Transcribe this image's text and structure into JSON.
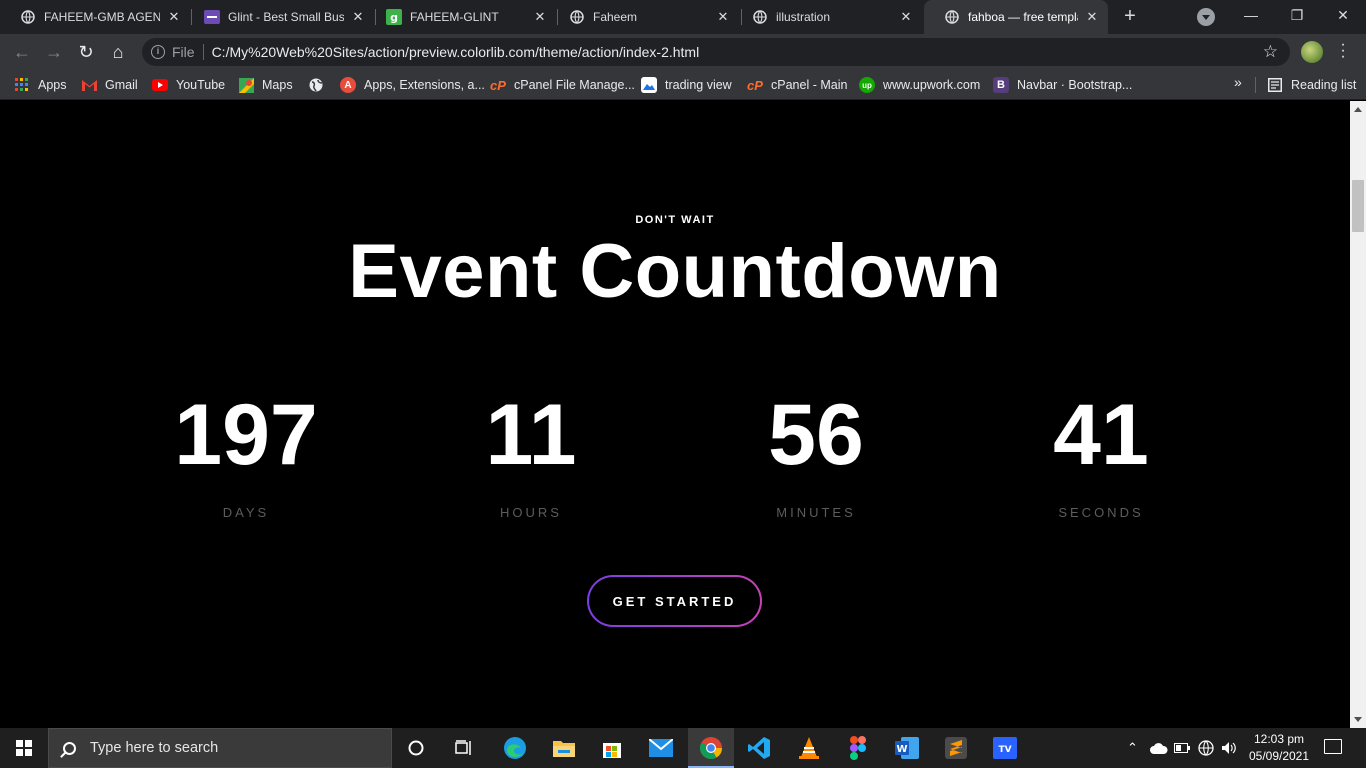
{
  "browser": {
    "tabs": [
      {
        "title": "FAHEEM-GMB AGENC",
        "favicon": "globe-icon",
        "active": false
      },
      {
        "title": "Glint - Best Small Busi",
        "favicon": "colorlib-icon",
        "active": false
      },
      {
        "title": "FAHEEM-GLINT",
        "favicon": "green-g-icon",
        "active": false
      },
      {
        "title": "Faheem",
        "favicon": "globe-icon",
        "active": false
      },
      {
        "title": "illustration",
        "favicon": "globe-icon",
        "active": false
      },
      {
        "title": "fahboa — free templat",
        "favicon": "globe-icon",
        "active": true
      }
    ],
    "address": {
      "scheme_label": "File",
      "url": "C:/My%20Web%20Sites/action/preview.colorlib.com/theme/action/index-2.html"
    },
    "bookmarks": [
      {
        "label": "Apps",
        "icon": "apps-grid-icon"
      },
      {
        "label": "Gmail",
        "icon": "gmail-icon"
      },
      {
        "label": "YouTube",
        "icon": "youtube-icon"
      },
      {
        "label": "Maps",
        "icon": "maps-icon"
      },
      {
        "label": "",
        "icon": "globe-icon"
      },
      {
        "label": "Apps, Extensions, a...",
        "icon": "red-a-icon"
      },
      {
        "label": "cPanel File Manage...",
        "icon": "cpanel-icon"
      },
      {
        "label": "trading view",
        "icon": "image-icon"
      },
      {
        "label": "cPanel - Main",
        "icon": "cpanel-icon"
      },
      {
        "label": "www.upwork.com",
        "icon": "upwork-icon"
      },
      {
        "label": "Navbar · Bootstrap...",
        "icon": "bootstrap-icon"
      }
    ],
    "bookmarks_more": "»",
    "reading_list": "Reading list"
  },
  "page": {
    "eyebrow": "DON'T WAIT",
    "headline": "Event Countdown",
    "countdown": [
      {
        "value": "197",
        "label": "DAYS"
      },
      {
        "value": "11",
        "label": "HOURS"
      },
      {
        "value": "56",
        "label": "MINUTES"
      },
      {
        "value": "41",
        "label": "SECONDS"
      }
    ],
    "cta_label": "GET STARTED",
    "colors": {
      "background": "#000000",
      "cta_gradient_start": "#7b3fe4",
      "cta_gradient_end": "#c742b5"
    }
  },
  "taskbar": {
    "search_placeholder": "Type here to search",
    "time": "12:03 pm",
    "date": "05/09/2021"
  }
}
